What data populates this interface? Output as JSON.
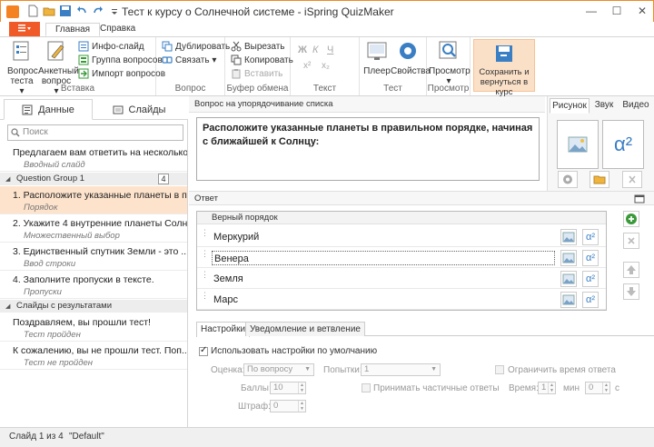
{
  "window": {
    "title": "Тест к курсу о Солнечной системе - iSpring QuizMaker",
    "min": "—",
    "max": "☐",
    "close": "✕"
  },
  "ribbon_tabs": {
    "file": "",
    "home": "Главная",
    "help": "Справка"
  },
  "ribbon": {
    "insert": {
      "label": "Вставка",
      "question_test_1": "Вопрос",
      "question_test_2": "теста ▾",
      "survey_1": "Анкетный",
      "survey_2": "вопрос ▾",
      "info_slide": "Инфо-слайд",
      "question_group": "Группа вопросов",
      "import_questions": "Импорт вопросов"
    },
    "question": {
      "label": "Вопрос",
      "duplicate": "Дублировать",
      "link": "Связать ▾"
    },
    "clipboard": {
      "label": "Буфер обмена",
      "cut": "Вырезать",
      "copy": "Копировать",
      "paste": "Вставить"
    },
    "text": {
      "label": "Текст",
      "bold": "Ж",
      "italic": "К",
      "underline": "Ч",
      "x2sup": "x²",
      "x2sub": "x₂"
    },
    "test": {
      "label": "Тест",
      "player": "Плеер",
      "properties": "Свойства"
    },
    "preview": {
      "label": "Просмотр",
      "preview_btn": "Просмотр ▾"
    },
    "save": {
      "line1": "Сохранить и",
      "line2": "вернуться в курс"
    }
  },
  "left_panel": {
    "tab_data": "Данные",
    "tab_slides": "Слайды",
    "search_placeholder": "Поиск",
    "intro": {
      "title": "Предлагаем вам ответить на несколько...",
      "subtitle": "Вводный слайд"
    },
    "group1": {
      "name": "Question Group 1",
      "count": "4",
      "toggle": "◢"
    },
    "questions": [
      {
        "title": "1. Расположите указанные планеты в п...",
        "type": "Порядок"
      },
      {
        "title": "2. Укажите 4 внутренние планеты Солн...",
        "type": "Множественный выбор"
      },
      {
        "title": "3. Единственный спутник Земли - это ...",
        "type": "Ввод строки"
      },
      {
        "title": "4. Заполните пропуски в тексте.",
        "type": "Пропуски"
      }
    ],
    "group2": {
      "name": "Слайды с результатами",
      "toggle": "◢"
    },
    "results": [
      {
        "title": "Поздравляем, вы прошли тест!",
        "type": "Тест пройден"
      },
      {
        "title": "К сожалению, вы не прошли тест. Поп...",
        "type": "Тест не пройден"
      }
    ]
  },
  "question_panel": {
    "header": "Вопрос на упорядочивание списка",
    "text": "Расположите указанные планеты в правильном порядке, начиная с ближайшей к Солнцу:"
  },
  "media": {
    "tab_picture": "Рисунок",
    "tab_sound": "Звук",
    "tab_video": "Видео",
    "formula_label": "α²"
  },
  "answer_panel": {
    "header": "Ответ",
    "col_header": "Верный порядок",
    "items": [
      "Меркурий",
      "Венера",
      "Земля",
      "Марс"
    ],
    "formula_label": "α²"
  },
  "settings": {
    "tab_settings": "Настройки",
    "tab_feedback": "Уведомление и ветвление",
    "use_default": "Использовать настройки по умолчанию",
    "scoring_label": "Оценка:",
    "scoring_value": "По вопросу",
    "attempts_label": "Попытки:",
    "attempts_value": "1",
    "limit_time": "Ограничить время ответа",
    "points_label": "Баллы:",
    "points_value": "10",
    "partial": "Принимать частичные ответы",
    "time_label": "Время:",
    "time_min_value": "1",
    "min_label": "мин",
    "time_sec_value": "0",
    "sec_label": "с",
    "penalty_label": "Штраф:",
    "penalty_value": "0"
  },
  "status": {
    "slide": "Слайд 1 из 4",
    "theme": "\"Default\""
  },
  "colors": {
    "accent": "#f05a28",
    "selected": "#fde3cc",
    "blue_icon": "#3a7fc4"
  }
}
